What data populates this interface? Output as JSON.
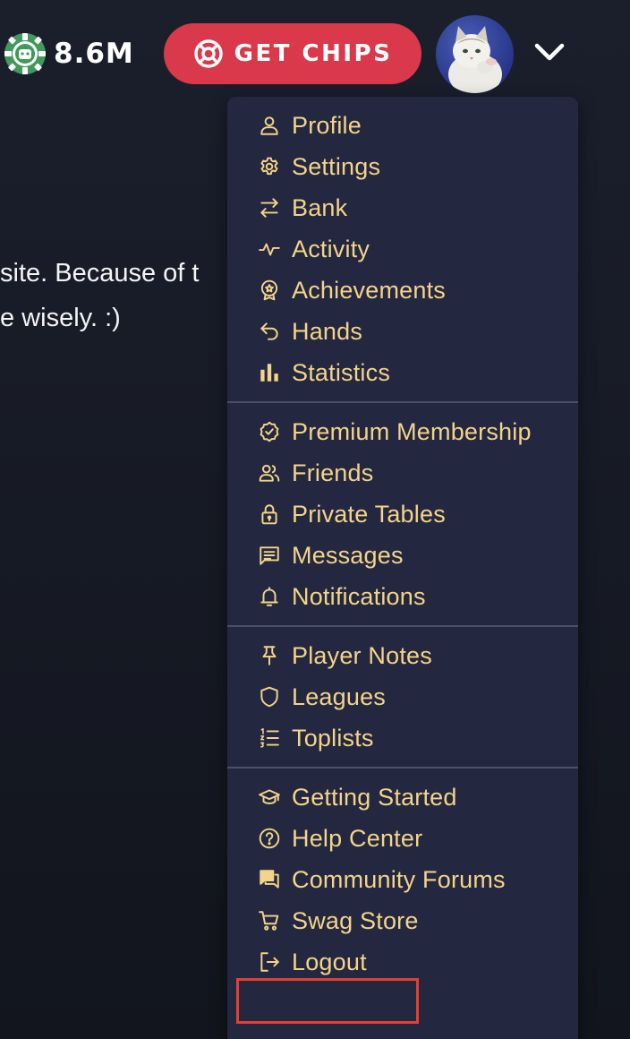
{
  "header": {
    "chip_balance": "8.6M",
    "get_chips_label": "GET CHIPS",
    "accent_color": "#d9394a",
    "chip_color": "#3f9a5c"
  },
  "background_text": {
    "line1": "site. Because of t",
    "line2": "e wisely. :)"
  },
  "menu": {
    "text_color": "#f4d48a",
    "sections": [
      {
        "items": [
          {
            "label": "Profile",
            "icon": "user-icon"
          },
          {
            "label": "Settings",
            "icon": "gear-icon"
          },
          {
            "label": "Bank",
            "icon": "transfer-arrows-icon"
          },
          {
            "label": "Activity",
            "icon": "pulse-icon"
          },
          {
            "label": "Achievements",
            "icon": "award-badge-icon"
          },
          {
            "label": "Hands",
            "icon": "undo-arrow-icon"
          },
          {
            "label": "Statistics",
            "icon": "bar-chart-icon"
          }
        ]
      },
      {
        "items": [
          {
            "label": "Premium Membership",
            "icon": "verified-badge-icon"
          },
          {
            "label": "Friends",
            "icon": "users-icon"
          },
          {
            "label": "Private Tables",
            "icon": "lock-icon"
          },
          {
            "label": "Messages",
            "icon": "message-icon"
          },
          {
            "label": "Notifications",
            "icon": "bell-icon"
          }
        ]
      },
      {
        "items": [
          {
            "label": "Player Notes",
            "icon": "pin-icon"
          },
          {
            "label": "Leagues",
            "icon": "shield-icon"
          },
          {
            "label": "Toplists",
            "icon": "numbered-list-icon"
          }
        ]
      },
      {
        "items": [
          {
            "label": "Getting Started",
            "icon": "graduation-cap-icon"
          },
          {
            "label": "Help Center",
            "icon": "help-circle-icon"
          },
          {
            "label": "Community Forums",
            "icon": "forum-icon"
          },
          {
            "label": "Swag Store",
            "icon": "shopping-cart-icon"
          },
          {
            "label": "Logout",
            "icon": "logout-icon"
          }
        ]
      }
    ]
  },
  "highlight_color": "#e4402e"
}
